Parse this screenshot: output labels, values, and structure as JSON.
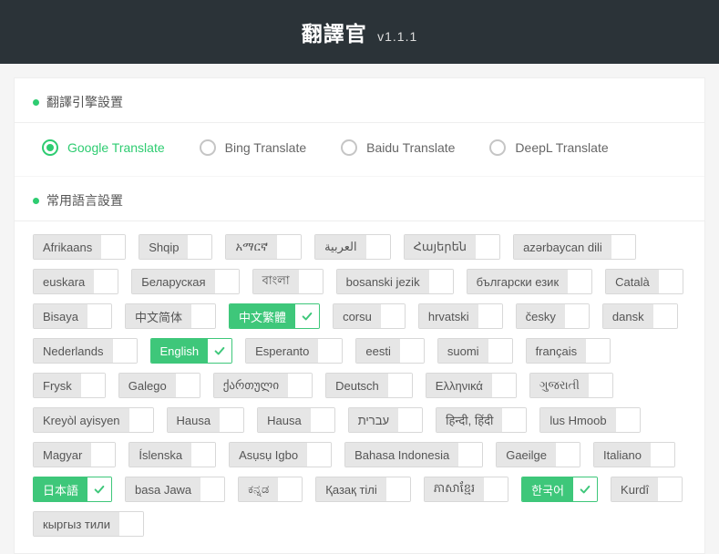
{
  "header": {
    "title": "翻譯官",
    "version": "v1.1.1"
  },
  "sections": {
    "engine_title": "翻譯引擎設置",
    "lang_title": "常用語言設置"
  },
  "engines": [
    {
      "id": "google",
      "label": "Google Translate",
      "selected": true
    },
    {
      "id": "bing",
      "label": "Bing Translate",
      "selected": false
    },
    {
      "id": "baidu",
      "label": "Baidu Translate",
      "selected": false
    },
    {
      "id": "deepl",
      "label": "DeepL Translate",
      "selected": false
    }
  ],
  "languages": [
    {
      "label": "Afrikaans",
      "selected": false
    },
    {
      "label": "Shqip",
      "selected": false
    },
    {
      "label": "አማርኛ",
      "selected": false
    },
    {
      "label": "العربية",
      "selected": false
    },
    {
      "label": "Հայերեն",
      "selected": false
    },
    {
      "label": "azərbaycan dili",
      "selected": false
    },
    {
      "label": "euskara",
      "selected": false
    },
    {
      "label": "Беларуская",
      "selected": false
    },
    {
      "label": "বাংলা",
      "selected": false
    },
    {
      "label": "bosanski jezik",
      "selected": false
    },
    {
      "label": "български език",
      "selected": false
    },
    {
      "label": "Català",
      "selected": false
    },
    {
      "label": "Bisaya",
      "selected": false
    },
    {
      "label": "中文简体",
      "selected": false
    },
    {
      "label": "中文繁體",
      "selected": true
    },
    {
      "label": "corsu",
      "selected": false
    },
    {
      "label": "hrvatski",
      "selected": false
    },
    {
      "label": "česky",
      "selected": false
    },
    {
      "label": "dansk",
      "selected": false
    },
    {
      "label": "Nederlands",
      "selected": false
    },
    {
      "label": "English",
      "selected": true
    },
    {
      "label": "Esperanto",
      "selected": false
    },
    {
      "label": "eesti",
      "selected": false
    },
    {
      "label": "suomi",
      "selected": false
    },
    {
      "label": "français",
      "selected": false
    },
    {
      "label": "Frysk",
      "selected": false
    },
    {
      "label": "Galego",
      "selected": false
    },
    {
      "label": "ქართული",
      "selected": false
    },
    {
      "label": "Deutsch",
      "selected": false
    },
    {
      "label": "Ελληνικά",
      "selected": false
    },
    {
      "label": "ગુજરાતી",
      "selected": false
    },
    {
      "label": "Kreyòl ayisyen",
      "selected": false
    },
    {
      "label": "Hausa",
      "selected": false
    },
    {
      "label": "Hausa",
      "selected": false
    },
    {
      "label": "עברית",
      "selected": false
    },
    {
      "label": "हिन्दी, हिंदी",
      "selected": false
    },
    {
      "label": "lus Hmoob",
      "selected": false
    },
    {
      "label": "Magyar",
      "selected": false
    },
    {
      "label": "Íslenska",
      "selected": false
    },
    {
      "label": "Asụsụ Igbo",
      "selected": false
    },
    {
      "label": "Bahasa Indonesia",
      "selected": false
    },
    {
      "label": "Gaeilge",
      "selected": false
    },
    {
      "label": "Italiano",
      "selected": false
    },
    {
      "label": "日本語",
      "selected": true
    },
    {
      "label": "basa Jawa",
      "selected": false
    },
    {
      "label": "ಕನ್ನಡ",
      "selected": false
    },
    {
      "label": "Қазақ тілі",
      "selected": false
    },
    {
      "label": "ភាសាខ្មែរ",
      "selected": false
    },
    {
      "label": "한국어",
      "selected": true
    },
    {
      "label": "Kurdî",
      "selected": false
    },
    {
      "label": "кыргыз тили",
      "selected": false
    }
  ]
}
